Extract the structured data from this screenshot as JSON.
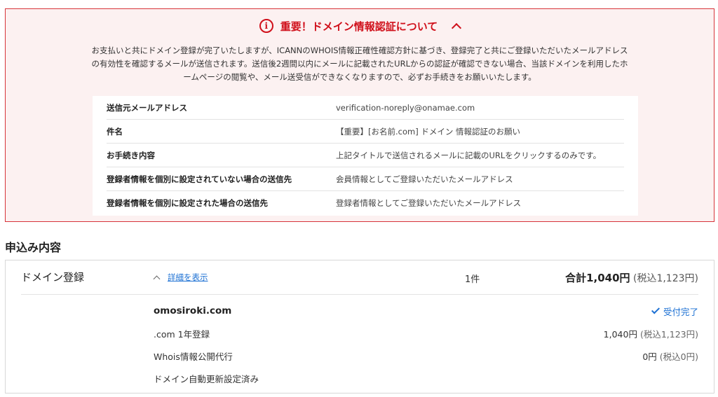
{
  "notice": {
    "icon": "info-circle-icon",
    "title": "重要！ドメイン情報認証について",
    "toggle_icon": "chevron-up-icon",
    "body_line1": "お支払いと共にドメイン登録が完了いたしますが、ICANNのWHOIS情報正確性確認方針に基づき、登録完了と共にご登録いただいたメールアドレス",
    "body_line2": "の有効性を確認するメールが送信されます。送信後2週間以内にメールに記載されたURLからの認証が確認できない場合、当該ドメインを利用したホ",
    "body_line3": "ームページの閲覧や、メール送受信ができなくなりますので、必ずお手続きをお願いいたします。",
    "rows": [
      {
        "label": "送信元メールアドレス",
        "value": "verification-noreply@onamae.com"
      },
      {
        "label": "件名",
        "value": "【重要】[お名前.com] ドメイン 情報認証のお願い"
      },
      {
        "label": "お手続き内容",
        "value": "上記タイトルで送信されるメールに記載のURLをクリックするのみです。"
      },
      {
        "label": "登録者情報を個別に設定されていない場合の送信先",
        "value": "会員情報としてご登録いただいたメールアドレス"
      },
      {
        "label": "登録者情報を個別に設定された場合の送信先",
        "value": "登録者情報としてご登録いただいたメールアドレス"
      }
    ]
  },
  "order": {
    "section_title": "申込み内容",
    "service_name": "ドメイン登録",
    "detail_link": "詳細を表示",
    "count": "1件",
    "total_label": "合計1,040円",
    "total_tax": "(税込1,123円)",
    "domain": "omosiroki.com",
    "status": "受付完了",
    "items": [
      {
        "name": ".com 1年登録",
        "price": "1,040円",
        "tax": "(税込1,123円)"
      },
      {
        "name": "Whois情報公開代行",
        "price": "0円",
        "tax": "(税込0円)"
      },
      {
        "name": "ドメイン自動更新設定済み",
        "price": "",
        "tax": ""
      }
    ]
  },
  "colors": {
    "accent_red": "#d0101b",
    "link_blue": "#1a6fd3"
  }
}
